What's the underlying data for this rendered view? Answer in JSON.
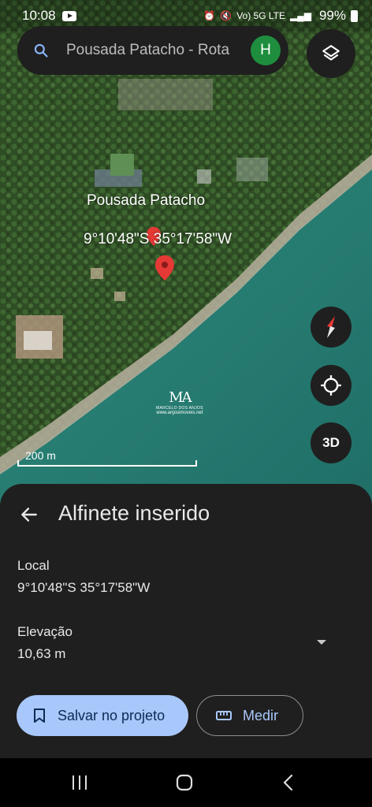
{
  "status_bar": {
    "time": "10:08",
    "indicators": "Vo) 5G LTE",
    "battery": "99%"
  },
  "search": {
    "text": "Pousada Patacho - Rota",
    "avatar_letter": "H"
  },
  "map": {
    "place_name": "Pousada Patacho",
    "pin_coordinates": "9°10'48\"S 35°17'58\"W",
    "watermark_logo": "MA",
    "watermark_line1": "MARCELO DOS ANJOS",
    "watermark_line2": "www.anjosimoveis.net",
    "scale_label": "200 m",
    "three_d_label": "3D"
  },
  "sheet": {
    "title": "Alfinete inserido",
    "local_label": "Local",
    "local_value": "9°10'48\"S 35°17'58\"W",
    "elevation_label": "Elevação",
    "elevation_value": "10,63 m",
    "save_label": "Salvar no projeto",
    "measure_label": "Medir"
  },
  "icons": {
    "search": "search-icon",
    "layers": "layers-icon",
    "compass": "compass-icon",
    "locate": "my-location-icon",
    "back": "back-arrow-icon",
    "bookmark": "bookmark-icon",
    "ruler": "ruler-icon"
  },
  "colors": {
    "accent": "#a8c7fa",
    "avatar": "#1e8e3e",
    "pin": "#e53935",
    "sheet_bg": "#1f1f1f"
  }
}
